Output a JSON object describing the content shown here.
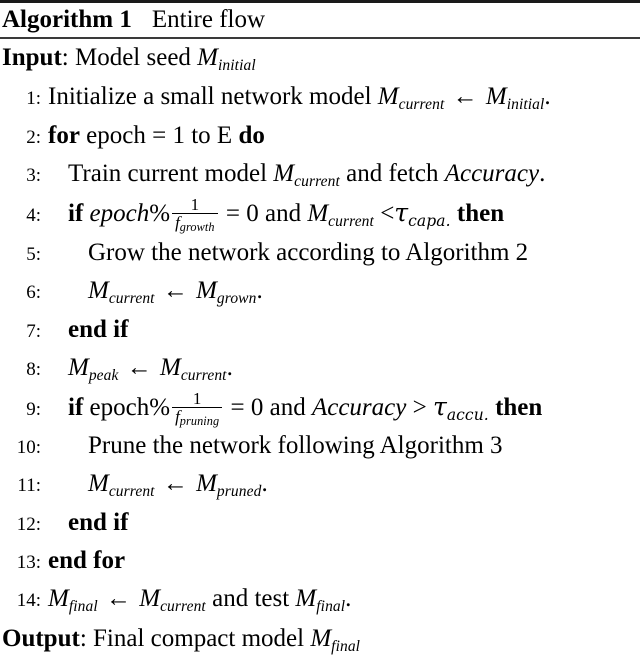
{
  "algorithm": {
    "label": "Algorithm 1",
    "title": "Entire flow",
    "input": {
      "keyword": "Input",
      "separator": ":",
      "text": "Model seed",
      "symbol": "M",
      "subscript": "initial"
    },
    "output": {
      "keyword": "Output",
      "separator": ":",
      "text": "Final compact model",
      "symbol": "M",
      "subscript": "final"
    },
    "steps": [
      {
        "num": "1:",
        "indent": 0,
        "text": "Initialize a small network model M_current <- M_initial."
      },
      {
        "num": "2:",
        "indent": 0,
        "text": "for epoch = 1 to E do"
      },
      {
        "num": "3:",
        "indent": 1,
        "text": "Train current model M_current and fetch Accuracy."
      },
      {
        "num": "4:",
        "indent": 1,
        "text": "if epoch% 1/f_growth = 0 and M_current < tau_capa. then"
      },
      {
        "num": "5:",
        "indent": 2,
        "text": "Grow the network according to Algorithm 2"
      },
      {
        "num": "6:",
        "indent": 2,
        "text": "M_current <- M_grown."
      },
      {
        "num": "7:",
        "indent": 1,
        "text": "end if"
      },
      {
        "num": "8:",
        "indent": 1,
        "text": "M_peak <- M_current."
      },
      {
        "num": "9:",
        "indent": 1,
        "text": "if epoch% 1/f_pruning = 0 and Accuracy > tau_accu. then"
      },
      {
        "num": "10:",
        "indent": 2,
        "text": "Prune the network following Algorithm 3"
      },
      {
        "num": "11:",
        "indent": 2,
        "text": "M_current <- M_pruned."
      },
      {
        "num": "12:",
        "indent": 1,
        "text": "end if"
      },
      {
        "num": "13:",
        "indent": 0,
        "text": "end for"
      },
      {
        "num": "14:",
        "indent": 0,
        "text": "M_final <- M_current and test M_final."
      }
    ],
    "tokens": {
      "for": "for",
      "do": "do",
      "if": "if",
      "then": "then",
      "end_if": "end if",
      "end_for": "end for",
      "epoch": "epoch",
      "percent": "%",
      "equals": "=",
      "zero": "0",
      "one": "1",
      "and": "and",
      "lt": "<",
      "gt": ">",
      "arrow": "←",
      "period": ".",
      "E": "E",
      "M": "M",
      "tau": "τ",
      "f": "f",
      "accuracy": "Accuracy",
      "sub_current": "current",
      "sub_initial": "initial",
      "sub_grown": "grown",
      "sub_peak": "peak",
      "sub_pruned": "pruned",
      "sub_final": "final",
      "sub_growth": "growth",
      "sub_pruning": "pruning",
      "sub_capa": "capa.",
      "sub_accu": "accu.",
      "s1_initialize": "Initialize a small network model",
      "s2_epoch_eq": "epoch = 1 to",
      "s3_train": "Train current model",
      "s3_fetch": "and fetch",
      "s5_grow": "Grow the network according to Algorithm 2",
      "s10_prune": "Prune the network following Algorithm 3",
      "s14_and_test": "and test"
    }
  }
}
